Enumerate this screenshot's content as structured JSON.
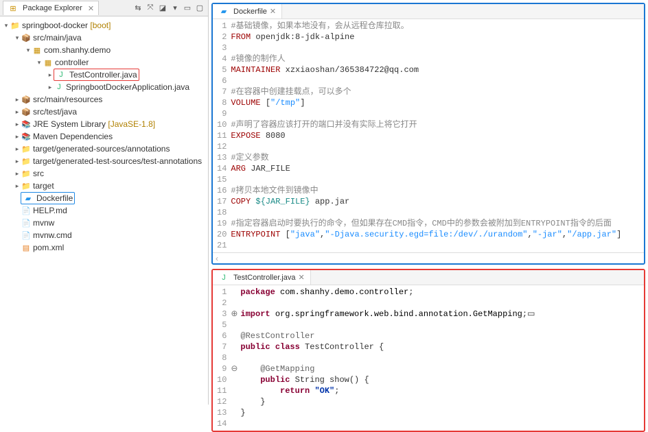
{
  "explorer": {
    "title": "Package Explorer",
    "project": {
      "name": "springboot-docker",
      "decorator": "[boot]"
    },
    "srcMainJava": "src/main/java",
    "pkgDemo": "com.shanhy.demo",
    "pkgController": "controller",
    "fileTestController": "TestController.java",
    "fileApp": "SpringbootDockerApplication.java",
    "srcMainResources": "src/main/resources",
    "srcTestJava": "src/test/java",
    "jre": "JRE System Library",
    "jreDec": "[JavaSE-1.8]",
    "maven": "Maven Dependencies",
    "genAnno": "target/generated-sources/annotations",
    "genTest": "target/generated-test-sources/test-annotations",
    "src": "src",
    "target": "target",
    "dockerfile": "Dockerfile",
    "help": "HELP.md",
    "mvnw": "mvnw",
    "mvnwCmd": "mvnw.cmd",
    "pom": "pom.xml"
  },
  "editor1": {
    "tab": "Dockerfile",
    "lines": [
      {
        "n": "1",
        "c": "<span class='c-comment'>#基础镜像，如果本地没有，会从远程仓库拉取。</span>"
      },
      {
        "n": "2",
        "c": "<span class='c-cmd'>FROM</span> openjdk:8-jdk-alpine"
      },
      {
        "n": "3",
        "c": ""
      },
      {
        "n": "4",
        "c": "<span class='c-comment'>#镜像的制作人</span>"
      },
      {
        "n": "5",
        "c": "<span class='c-cmd'>MAINTAINER</span> xzxiaoshan/365384722@qq.com"
      },
      {
        "n": "6",
        "c": ""
      },
      {
        "n": "7",
        "c": "<span class='c-comment'>#在容器中创建挂载点，可以多个</span>"
      },
      {
        "n": "8",
        "c": "<span class='c-cmd'>VOLUME</span> [<span class='c-string'>\"/tmp\"</span>]"
      },
      {
        "n": "9",
        "c": ""
      },
      {
        "n": "10",
        "c": "<span class='c-comment'>#声明了容器应该打开的端口并没有实际上将它打开</span>"
      },
      {
        "n": "11",
        "c": "<span class='c-cmd'>EXPOSE</span> 8080"
      },
      {
        "n": "12",
        "c": ""
      },
      {
        "n": "13",
        "c": "<span class='c-comment'>#定义参数</span>"
      },
      {
        "n": "14",
        "c": "<span class='c-cmd'>ARG</span> JAR_FILE"
      },
      {
        "n": "15",
        "c": ""
      },
      {
        "n": "16",
        "c": "<span class='c-comment'>#拷贝本地文件到镜像中</span>"
      },
      {
        "n": "17",
        "c": "<span class='c-cmd'>COPY</span> <span class='c-var'>${JAR_FILE}</span> app.jar"
      },
      {
        "n": "18",
        "c": ""
      },
      {
        "n": "19",
        "c": "<span class='c-comment'>#指定容器启动时要执行的命令，但如果存在CMD指令，CMD中的参数会被附加到ENTRYPOINT指令的后面</span>"
      },
      {
        "n": "20",
        "c": "<span class='c-cmd'>ENTRYPOINT</span> [<span class='c-string'>\"java\"</span>,<span class='c-string'>\"-Djava.security.egd=file:/dev/./urandom\"</span>,<span class='c-string'>\"-jar\"</span>,<span class='c-string'>\"/app.jar\"</span>]"
      },
      {
        "n": "21",
        "c": ""
      }
    ]
  },
  "editor2": {
    "tab": "TestController.java",
    "lines": [
      {
        "n": "1",
        "x": "",
        "c": "<span class='c-keyword'>package</span> <span class='c-pkg'>com.shanhy.demo.controller</span>;"
      },
      {
        "n": "2",
        "x": "",
        "c": ""
      },
      {
        "n": "3",
        "x": "⊕",
        "c": "<span class='c-keyword'>import</span> <span class='c-pkg'>org.springframework.web.bind.annotation.GetMapping</span>;▭"
      },
      {
        "n": "5",
        "x": "",
        "c": ""
      },
      {
        "n": "6",
        "x": "",
        "c": "<span class='c-anno'>@RestController</span>"
      },
      {
        "n": "7",
        "x": "",
        "c": "<span class='c-keyword'>public class</span> TestController {"
      },
      {
        "n": "8",
        "x": "",
        "c": ""
      },
      {
        "n": "9",
        "x": "⊖",
        "c": "    <span class='c-anno'>@GetMapping</span>"
      },
      {
        "n": "10",
        "x": "",
        "c": "    <span class='c-keyword'>public</span> String show() {"
      },
      {
        "n": "11",
        "x": "",
        "c": "        <span class='c-keyword'>return</span> <span class='c-keyword2'>\"OK\"</span>;"
      },
      {
        "n": "12",
        "x": "",
        "c": "    }"
      },
      {
        "n": "13",
        "x": "",
        "c": "}"
      },
      {
        "n": "14",
        "x": "",
        "c": ""
      }
    ]
  }
}
